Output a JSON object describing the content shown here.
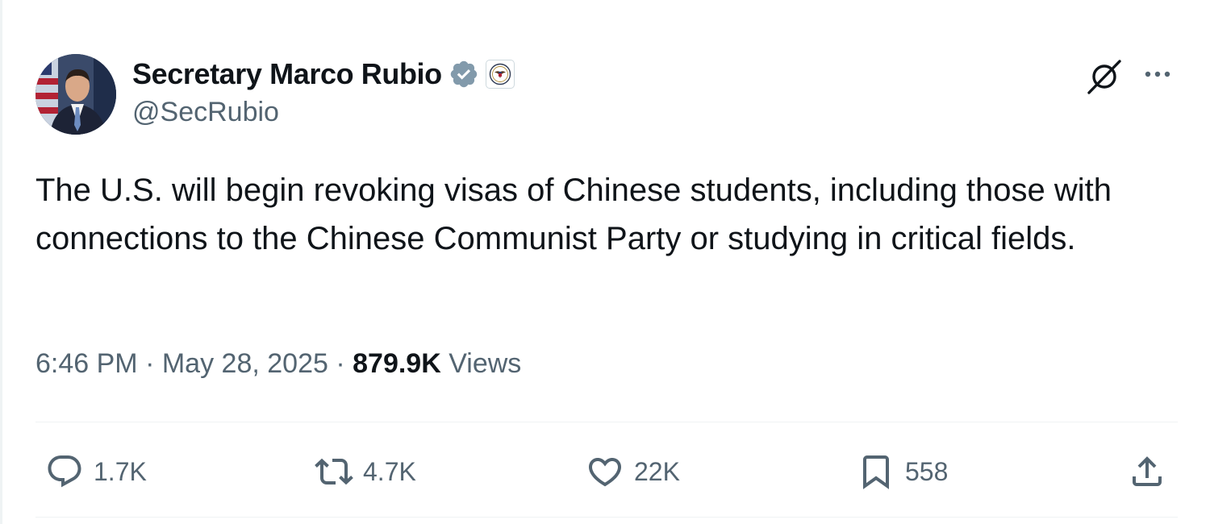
{
  "author": {
    "display_name": "Secretary Marco Rubio",
    "handle": "@SecRubio",
    "verified_icon": "verified-badge-icon",
    "affiliation_icon": "department-of-state-seal-icon"
  },
  "header_actions": {
    "grok_icon": "grok-icon",
    "more_icon": "more-icon"
  },
  "tweet": {
    "text": "The U.S. will begin revoking visas of Chinese students, including those with connections to the Chinese Communist Party or studying in critical fields.",
    "time": "6:46 PM",
    "separator": "·",
    "date": "May 28, 2025",
    "views_count": "879.9K",
    "views_label": "Views"
  },
  "actions": {
    "reply": {
      "icon": "reply-icon",
      "count": "1.7K"
    },
    "repost": {
      "icon": "repost-icon",
      "count": "4.7K"
    },
    "like": {
      "icon": "heart-icon",
      "count": "22K"
    },
    "bookmark": {
      "icon": "bookmark-icon",
      "count": "558"
    },
    "share": {
      "icon": "share-icon"
    }
  },
  "colors": {
    "text_primary": "#0f1419",
    "text_secondary": "#536471",
    "verified_gray": "#829aab",
    "divider": "#eff3f4"
  }
}
